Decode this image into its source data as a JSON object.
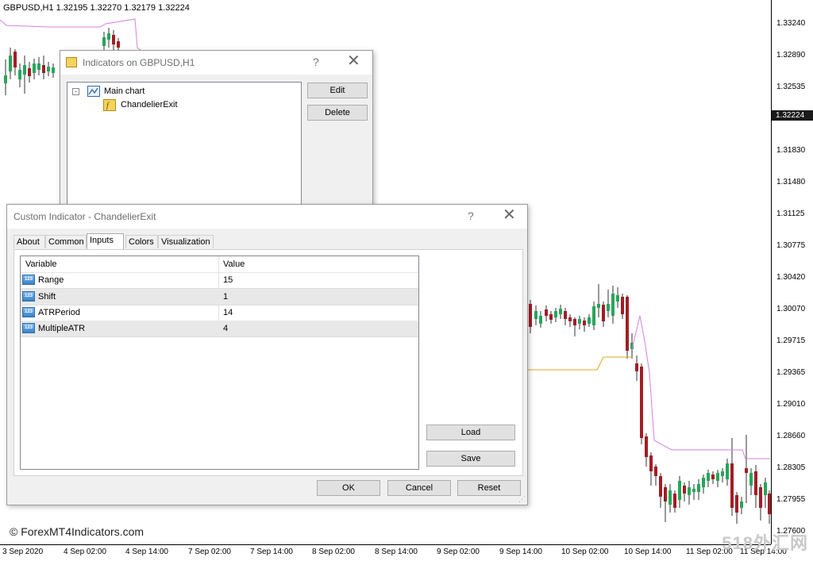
{
  "chart": {
    "header": "GBPUSD,H1  1.32195 1.32270 1.32179 1.32224",
    "price_labels": [
      "1.33240",
      "1.32890",
      "1.32535",
      "1.31830",
      "1.31480",
      "1.31125",
      "1.30775",
      "1.30420",
      "1.30070",
      "1.29715",
      "1.29365",
      "1.29010",
      "1.28660",
      "1.28305",
      "1.27955",
      "1.27600"
    ],
    "current_price": "1.32224",
    "time_labels": [
      "3 Sep 2020",
      "4 Sep 02:00",
      "4 Sep 14:00",
      "7 Sep 02:00",
      "7 Sep 14:00",
      "8 Sep 02:00",
      "8 Sep 14:00",
      "9 Sep 02:00",
      "9 Sep 14:00",
      "10 Sep 02:00",
      "10 Sep 14:00",
      "11 Sep 02:00",
      "11 Sep 14:00"
    ],
    "copyright": "© ForexMT4Indicators.com",
    "watermark": "518外汇网",
    "colors": {
      "bull": "#26a65b",
      "bear": "#a31d25",
      "chandelier_short": "#d67fe0",
      "chandelier_long": "#e0a626"
    }
  },
  "indicators_dialog": {
    "title": "Indicators on GBPUSD,H1",
    "help": "?",
    "close": "✕",
    "tree_root": "Main chart",
    "tree_child": "ChandelierExit",
    "edit_label": "Edit",
    "delete_label": "Delete"
  },
  "custom_dialog": {
    "title": "Custom Indicator - ChandelierExit",
    "help": "?",
    "close": "✕",
    "tabs": [
      "About",
      "Common",
      "Inputs",
      "Colors",
      "Visualization"
    ],
    "active_tab": "Inputs",
    "col_variable": "Variable",
    "col_value": "Value",
    "type_icon": "123",
    "rows": [
      {
        "variable": "Range",
        "value": "15"
      },
      {
        "variable": "Shift",
        "value": "1"
      },
      {
        "variable": "ATRPeriod",
        "value": "14"
      },
      {
        "variable": "MultipleATR",
        "value": "4"
      }
    ],
    "load_label": "Load",
    "save_label": "Save",
    "ok_label": "OK",
    "cancel_label": "Cancel",
    "reset_label": "Reset"
  }
}
